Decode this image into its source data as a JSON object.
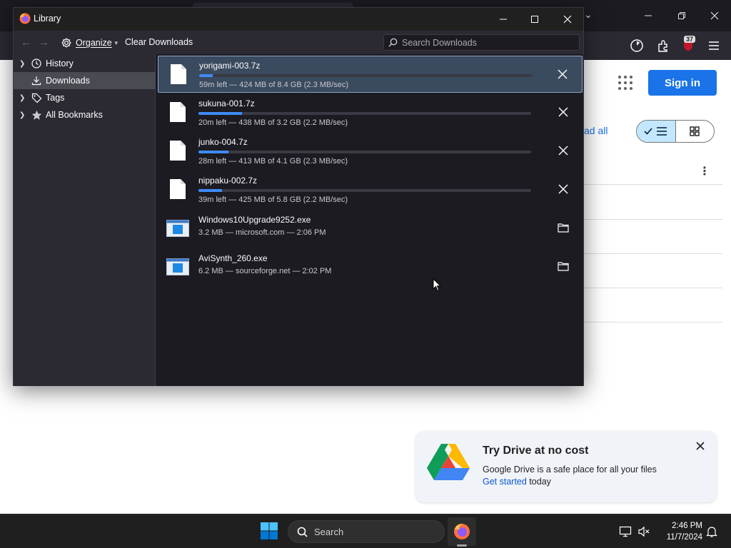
{
  "background_browser": {
    "sign_in_label": "Sign in",
    "read_all_label": "ad all",
    "toolbar_badge": "37"
  },
  "drive_promo": {
    "title": "Try Drive at no cost",
    "text": "Google Drive is a safe place for all your files",
    "link_label": "Get started",
    "link_suffix": " today"
  },
  "library": {
    "window_title": "Library",
    "toolbar": {
      "organize_label": "Organize",
      "clear_label": "Clear Downloads",
      "search_placeholder": "Search Downloads"
    },
    "sidebar": {
      "items": [
        {
          "label": "History",
          "icon": "clock-icon",
          "selected": false
        },
        {
          "label": "Downloads",
          "icon": "download-icon",
          "selected": true
        },
        {
          "label": "Tags",
          "icon": "tag-icon",
          "selected": false
        },
        {
          "label": "All Bookmarks",
          "icon": "star-icon",
          "selected": false
        }
      ]
    },
    "downloads": [
      {
        "name": "yorigami-003.7z",
        "status": "59m left — 424 MB of 8.4 GB (2.3 MB/sec)",
        "progress": 0.04,
        "in_progress": true,
        "selected": true
      },
      {
        "name": "sukuna-001.7z",
        "status": "20m left — 438 MB of 3.2 GB (2.2 MB/sec)",
        "progress": 0.13,
        "in_progress": true,
        "selected": false
      },
      {
        "name": "junko-004.7z",
        "status": "28m left — 413 MB of 4.1 GB (2.3 MB/sec)",
        "progress": 0.09,
        "in_progress": true,
        "selected": false
      },
      {
        "name": "nippaku-002.7z",
        "status": "39m left — 425 MB of 5.8 GB (2.2 MB/sec)",
        "progress": 0.07,
        "in_progress": true,
        "selected": false
      },
      {
        "name": "Windows10Upgrade9252.exe",
        "status": "3.2 MB — microsoft.com — 2:06 PM",
        "in_progress": false,
        "selected": false
      },
      {
        "name": "AviSynth_260.exe",
        "status": "6.2 MB — sourceforge.net — 2:02 PM",
        "in_progress": false,
        "selected": false
      }
    ]
  },
  "taskbar": {
    "search_placeholder": "Search",
    "time": "2:46 PM",
    "date": "11/7/2024"
  },
  "colors": {
    "accent": "#1a73e8",
    "progress": "#3e8bf5",
    "library_bg": "#1c1b22",
    "sidebar_bg": "#2b2a33"
  }
}
